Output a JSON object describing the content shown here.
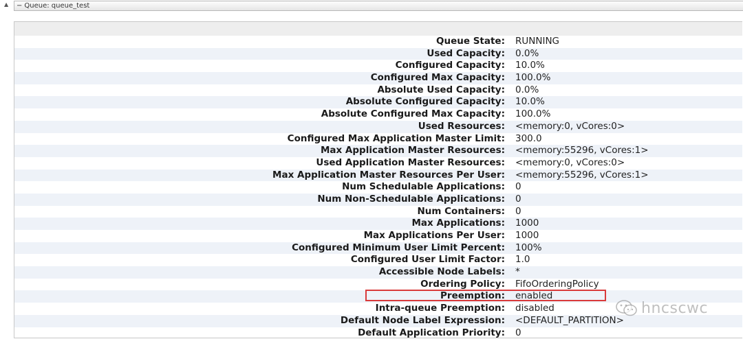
{
  "queue_header": {
    "expander_glyph": "▲",
    "collapse_glyph": "−",
    "title": "Queue: queue_test"
  },
  "queue_info": {
    "rows": [
      {
        "label": "Queue State:",
        "value": "RUNNING"
      },
      {
        "label": "Used Capacity:",
        "value": "0.0%"
      },
      {
        "label": "Configured Capacity:",
        "value": "10.0%"
      },
      {
        "label": "Configured Max Capacity:",
        "value": "100.0%"
      },
      {
        "label": "Absolute Used Capacity:",
        "value": "0.0%"
      },
      {
        "label": "Absolute Configured Capacity:",
        "value": "10.0%"
      },
      {
        "label": "Absolute Configured Max Capacity:",
        "value": "100.0%"
      },
      {
        "label": "Used Resources:",
        "value": "<memory:0, vCores:0>"
      },
      {
        "label": "Configured Max Application Master Limit:",
        "value": "300.0"
      },
      {
        "label": "Max Application Master Resources:",
        "value": "<memory:55296, vCores:1>"
      },
      {
        "label": "Used Application Master Resources:",
        "value": "<memory:0, vCores:0>"
      },
      {
        "label": "Max Application Master Resources Per User:",
        "value": "<memory:55296, vCores:1>"
      },
      {
        "label": "Num Schedulable Applications:",
        "value": "0"
      },
      {
        "label": "Num Non-Schedulable Applications:",
        "value": "0"
      },
      {
        "label": "Num Containers:",
        "value": "0"
      },
      {
        "label": "Max Applications:",
        "value": "1000"
      },
      {
        "label": "Max Applications Per User:",
        "value": "1000"
      },
      {
        "label": "Configured Minimum User Limit Percent:",
        "value": "100%"
      },
      {
        "label": "Configured User Limit Factor:",
        "value": "1.0"
      },
      {
        "label": "Accessible Node Labels:",
        "value": "*"
      },
      {
        "label": "Ordering Policy:",
        "value": "FifoOrderingPolicy"
      },
      {
        "label": "Preemption:",
        "value": "enabled"
      },
      {
        "label": "Intra-queue Preemption:",
        "value": "disabled"
      },
      {
        "label": "Default Node Label Expression:",
        "value": "<DEFAULT_PARTITION>"
      },
      {
        "label": "Default Application Priority:",
        "value": "0"
      }
    ]
  },
  "annotation": {
    "highlight_color": "#d93a3a"
  },
  "watermark": {
    "icon": "wechat-icon",
    "text": "hncscwc"
  }
}
